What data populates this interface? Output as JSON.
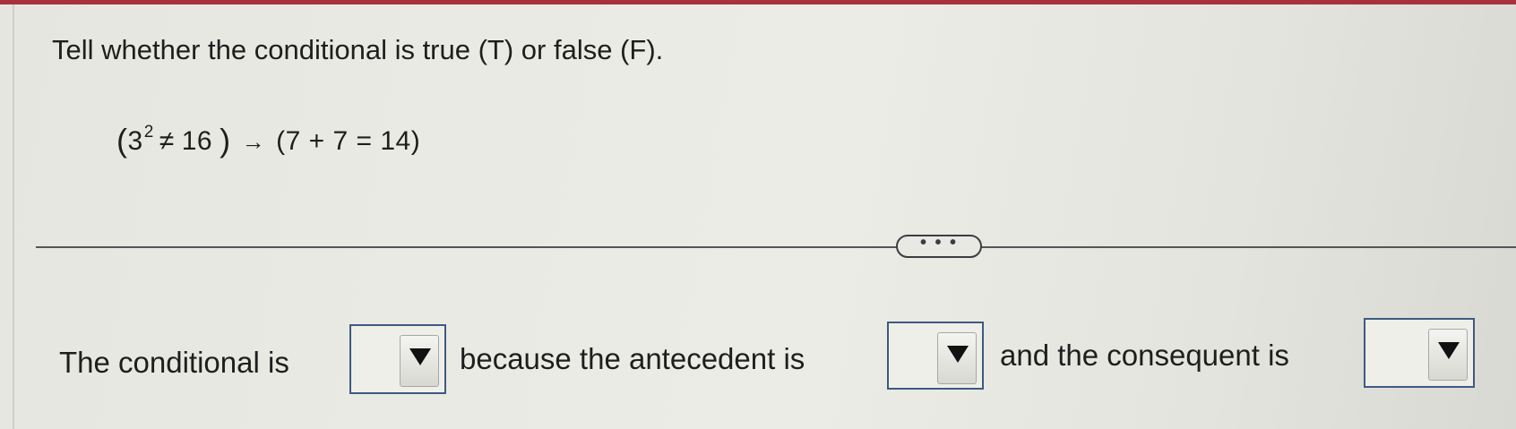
{
  "question": {
    "prompt": "Tell whether the conditional is true (T) or false (F)."
  },
  "expression": {
    "left_open": "(",
    "base": "3",
    "exponent": "2",
    "not_equal": "≠",
    "left_value": "16",
    "left_close": ")",
    "arrow": "→",
    "right_text": "(7 + 7 = 14)"
  },
  "more_button": {
    "label": "• • •"
  },
  "answer": {
    "part1": "The conditional is",
    "part2": "because the antecedent is",
    "part3": "and the consequent is",
    "dropdowns": [
      {
        "selected": "",
        "icon": "triangle-down-icon"
      },
      {
        "selected": "",
        "icon": "triangle-down-icon"
      },
      {
        "selected": "",
        "icon": "triangle-down-icon"
      }
    ]
  },
  "colors": {
    "top_bar": "#a8313d",
    "dropdown_border": "#3d5a82",
    "text": "#1e1e1e"
  }
}
